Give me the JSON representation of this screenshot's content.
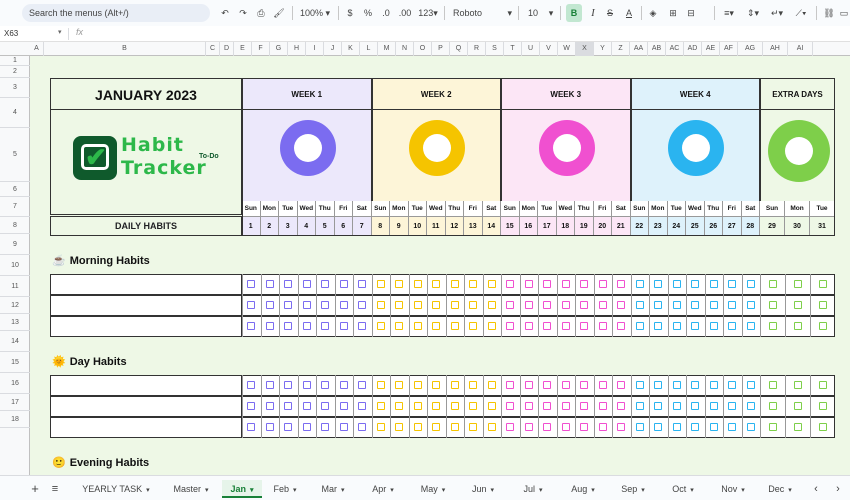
{
  "toolbar": {
    "search_placeholder": "Search the menus (Alt+/)",
    "undo": "↶",
    "redo": "↷",
    "print": "⎙",
    "paint": "🖌",
    "zoom": "100%",
    "currency": "$",
    "percent": "%",
    "dec_decrease": ".0",
    "dec_increase": ".00",
    "num_format": "123",
    "font": "Roboto",
    "font_size": "10",
    "bold": "B",
    "italic": "I",
    "strike": "S",
    "text_color": "A"
  },
  "formula_bar": {
    "cell_ref": "X63",
    "fx": "fx",
    "value": ""
  },
  "columns": [
    "A",
    "B",
    "C",
    "D",
    "E",
    "F",
    "G",
    "H",
    "I",
    "J",
    "K",
    "L",
    "M",
    "N",
    "O",
    "P",
    "Q",
    "R",
    "S",
    "T",
    "U",
    "V",
    "W",
    "X",
    "Y",
    "Z",
    "AA",
    "AB",
    "AC",
    "AD",
    "AE",
    "AF",
    "AG",
    "AH",
    "AI"
  ],
  "rows": [
    "1",
    "2",
    "3",
    "4",
    "5",
    "6",
    "7",
    "8",
    "9",
    "10",
    "11",
    "12",
    "13",
    "14",
    "15",
    "16",
    "17",
    "18"
  ],
  "sheet": {
    "title": "JANUARY 2023",
    "logo_line1": "Habit",
    "logo_line2": "Tracker",
    "logo_tag": "To-Do",
    "daily_habits_label": "DAILY HABITS",
    "weeks": [
      {
        "label": "WEEK 1",
        "color": "#7b6cf0",
        "bg": "#ece8fb",
        "days": [
          "Sun",
          "Mon",
          "Tue",
          "Wed",
          "Thu",
          "Fri",
          "Sat"
        ],
        "dates": [
          "1",
          "2",
          "3",
          "4",
          "5",
          "6",
          "7"
        ]
      },
      {
        "label": "WEEK 2",
        "color": "#f5c400",
        "bg": "#fdf5d8",
        "days": [
          "Sun",
          "Mon",
          "Tue",
          "Wed",
          "Thu",
          "Fri",
          "Sat"
        ],
        "dates": [
          "8",
          "9",
          "10",
          "11",
          "12",
          "13",
          "14"
        ]
      },
      {
        "label": "WEEK 3",
        "color": "#f050d0",
        "bg": "#fce6f6",
        "days": [
          "Sun",
          "Mon",
          "Tue",
          "Wed",
          "Thu",
          "Fri",
          "Sat"
        ],
        "dates": [
          "15",
          "16",
          "17",
          "18",
          "19",
          "20",
          "21"
        ]
      },
      {
        "label": "WEEK 4",
        "color": "#2ab4f0",
        "bg": "#def2fb",
        "days": [
          "Sun",
          "Mon",
          "Tue",
          "Wed",
          "Thu",
          "Fri",
          "Sat"
        ],
        "dates": [
          "22",
          "23",
          "24",
          "25",
          "26",
          "27",
          "28"
        ]
      },
      {
        "label": "EXTRA DAYS",
        "color": "#7ecf4a",
        "bg": "#eef8e6",
        "days": [
          "Sun",
          "Mon",
          "Tue"
        ],
        "dates": [
          "29",
          "30",
          "31"
        ]
      }
    ],
    "sections": [
      {
        "icon": "☕",
        "label": "Morning Habits"
      },
      {
        "icon": "🌞",
        "label": "Day Habits"
      },
      {
        "icon": "🙂",
        "label": "Evening Habits"
      }
    ]
  },
  "tabs": [
    "YEARLY TASK",
    "Master",
    "Jan",
    "Feb",
    "Mar",
    "Apr",
    "May",
    "Jun",
    "Jul",
    "Aug",
    "Sep",
    "Oct",
    "Nov",
    "Dec"
  ],
  "active_tab": "Jan",
  "tab_add": "+",
  "tab_list": "≡"
}
